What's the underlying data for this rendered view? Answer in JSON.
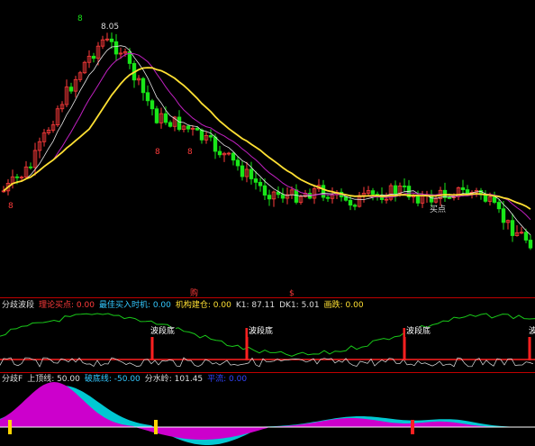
{
  "colors": {
    "bg": "#000000",
    "up": "#ff3b3b",
    "down": "#19e619",
    "ma_yellow": "#ffe033",
    "ma_white": "#e8e8e8",
    "ma_purple": "#c020c0",
    "magenta_fill": "#cc00cc",
    "cyan_fill": "#00c8d2",
    "red_bar": "#ff2020",
    "yellow_bar": "#ffd400",
    "green_line": "#19c819",
    "white_line": "#e0e0e0",
    "grid_red": "#c00000"
  },
  "price_panel": {
    "high_label": "8.05",
    "markers": [
      "8",
      "8",
      "8",
      "8"
    ],
    "buy_label": "买点"
  },
  "middle_marks": {
    "left": "购",
    "right": "$"
  },
  "indicator1": {
    "name": "分歧波段",
    "fields": [
      {
        "label": "理论买点:",
        "value": "0.00",
        "color": "#ff3b3b"
      },
      {
        "label": "最佳买入时机:",
        "value": "0.00",
        "color": "#33c8ff"
      },
      {
        "label": "机构建仓:",
        "value": "0.00",
        "color": "#ffe033"
      },
      {
        "label": "K1:",
        "value": "87.11",
        "color": "#dddddd"
      },
      {
        "label": "DK1:",
        "value": "5.01",
        "color": "#dddddd"
      },
      {
        "label": "画跌:",
        "value": "0.00",
        "color": "#ffe033"
      }
    ],
    "signal_label": "波段底",
    "signal_count": 4
  },
  "indicator2": {
    "name": "分歧F",
    "fields": [
      {
        "label": "上顶线:",
        "value": "50.00",
        "color": "#dddddd"
      },
      {
        "label": "破底线:",
        "value": "-50.00",
        "color": "#33c8ff"
      },
      {
        "label": "分水岭:",
        "value": "101.45",
        "color": "#dddddd"
      },
      {
        "label": "平流:",
        "value": "0.00",
        "color": "#3344ff"
      }
    ]
  },
  "chart_data": {
    "type": "candlestick",
    "price_high": 8.05,
    "moving_averages": [
      "yellow",
      "white",
      "purple"
    ],
    "indicators": [
      "分歧波段",
      "分歧F"
    ]
  }
}
